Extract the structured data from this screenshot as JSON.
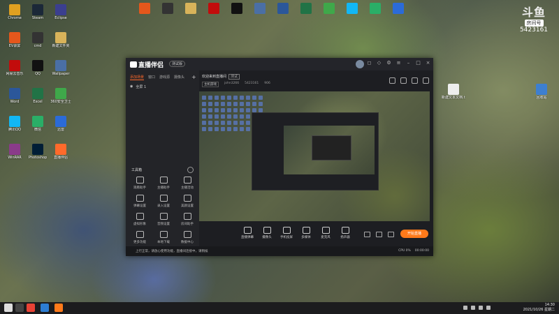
{
  "desktop": {
    "icons": [
      {
        "label": "Chrome",
        "color": "#e0a020"
      },
      {
        "label": "Steam",
        "color": "#1b2838"
      },
      {
        "label": "Eclipse",
        "color": "#3b3f8f"
      },
      {
        "label": "EV录屏",
        "color": "#e4571c"
      },
      {
        "label": "cmd",
        "color": "#333"
      },
      {
        "label": "新建文件夹",
        "color": "#d8b35a"
      },
      {
        "label": "网易云音乐",
        "color": "#c20c0c"
      },
      {
        "label": "QQ",
        "color": "#111"
      },
      {
        "label": "Wallpaper",
        "color": "#4a6fa5"
      },
      {
        "label": "Word",
        "color": "#2b579a"
      },
      {
        "label": "Excel",
        "color": "#217346"
      },
      {
        "label": "360安全卫士",
        "color": "#3fa84a"
      },
      {
        "label": "腾讯QQ",
        "color": "#12b7f5"
      },
      {
        "label": "微信",
        "color": "#2aae67"
      },
      {
        "label": "迅雷",
        "color": "#2b6bd8"
      },
      {
        "label": "WinRAR",
        "color": "#8a3b8a"
      },
      {
        "label": "Photoshop",
        "color": "#001e36"
      },
      {
        "label": "直播伴侣",
        "color": "#ff6a2b"
      }
    ],
    "right_icons": [
      {
        "label": "新建文本文档.txt",
        "color": "#eee"
      },
      {
        "label": "回收站",
        "color": "#3d7fd0"
      }
    ]
  },
  "brand": {
    "logo": "斗鱼",
    "tag": "房间号",
    "room_id": "5423161"
  },
  "app": {
    "title": "直播伴侣",
    "version": "测试版",
    "left_tabs": [
      "添加场景",
      "窗口",
      "游戏源",
      "摄像头"
    ],
    "scene_label": "全屏 1",
    "tools_title": "工具箱",
    "tools": [
      {
        "label": "观看助手"
      },
      {
        "label": "主播助手"
      },
      {
        "label": "主播活动"
      },
      {
        "label": "弹幕设置"
      },
      {
        "label": "录入设置"
      },
      {
        "label": "美颜设置"
      },
      {
        "label": "虚拟形象"
      },
      {
        "label": "音频设置"
      },
      {
        "label": "房间助手"
      },
      {
        "label": "更多功能"
      },
      {
        "label": "本地下载"
      },
      {
        "label": "数据中心"
      }
    ],
    "welcome": "欢迎来到直播间",
    "welcome_badge": "测试",
    "category": "主机游戏",
    "user": "john3266",
    "room_id": "5423161",
    "fans": "906",
    "controls": [
      {
        "label": "直播弹幕"
      },
      {
        "label": "摄像头"
      },
      {
        "label": "手机投屏"
      },
      {
        "label": "多媒体"
      },
      {
        "label": "麦克风"
      },
      {
        "label": "扬声器"
      }
    ],
    "go_live": "开始直播",
    "status_msg": "上行正常，请放心使用功能，直播间连接中，请稍候",
    "status_info": [
      "CPU 0%",
      "00:00:00"
    ]
  },
  "taskbar": {
    "time": "14:30",
    "date": "2021/10/26 星期二",
    "apps": [
      {
        "color": "#e94235"
      },
      {
        "color": "#2d7dd2"
      },
      {
        "color": "#ff7a1a"
      }
    ]
  }
}
